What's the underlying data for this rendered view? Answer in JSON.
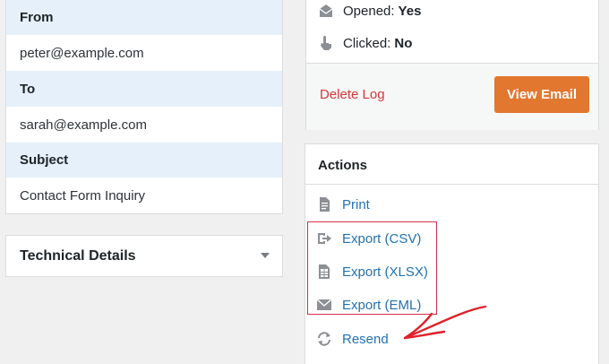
{
  "details": {
    "from_label": "From",
    "from_value": "peter@example.com",
    "to_label": "To",
    "to_value": "sarah@example.com",
    "subject_label": "Subject",
    "subject_value": "Contact Form Inquiry"
  },
  "technical": {
    "title": "Technical Details"
  },
  "status": {
    "opened_label": "Opened:",
    "opened_value": "Yes",
    "clicked_label": "Clicked:",
    "clicked_value": "No",
    "delete_label": "Delete Log",
    "view_label": "View Email"
  },
  "actions": {
    "title": "Actions",
    "items": [
      {
        "label": "Print",
        "icon": "document-icon"
      },
      {
        "label": "Export (CSV)",
        "icon": "export-icon"
      },
      {
        "label": "Export (XLSX)",
        "icon": "spreadsheet-icon"
      },
      {
        "label": "Export (EML)",
        "icon": "envelope-icon"
      },
      {
        "label": "Resend",
        "icon": "refresh-icon"
      }
    ]
  },
  "colors": {
    "accent_button": "#e27730",
    "link": "#2271b1",
    "danger": "#d63638",
    "annotation": "#e0202a",
    "header_row_bg": "#e6f0fa"
  }
}
